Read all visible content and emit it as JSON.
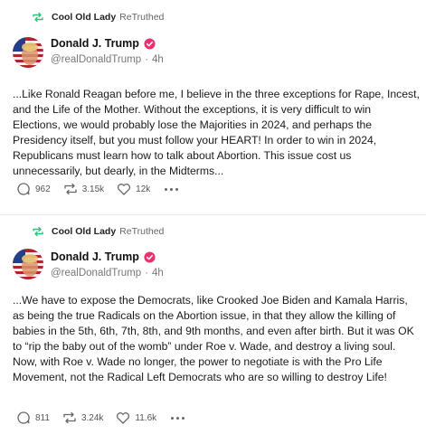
{
  "posts": [
    {
      "retruth_user": "Cool Old Lady",
      "retruth_action": "ReTruthed",
      "author_name": "Donald J. Trump",
      "author_handle": "@realDonaldTrump",
      "separator": "·",
      "time": "4h",
      "text": "...Like Ronald Reagan before me, I believe in the three exceptions for Rape, Incest, and the Life of the Mother. Without the exceptions, it is very difficult to win Elections, we would probably lose the Majorities in 2024, and perhaps the Presidency itself, but you must follow your HEART! In order to win in 2024, Republicans must learn how to talk about Abortion. This issue cost us unnecessarily, but dearly, in the Midterms...",
      "replies": "962",
      "retruths": "3.15k",
      "likes": "12k"
    },
    {
      "retruth_user": "Cool Old Lady",
      "retruth_action": "ReTruthed",
      "author_name": "Donald J. Trump",
      "author_handle": "@realDonaldTrump",
      "separator": "·",
      "time": "4h",
      "text": "...We have to expose the Democrats, like Crooked Joe Biden and Kamala Harris, as being the true Radicals on the Abortion issue, in that they allow the killing of babies in the 5th, 6th, 7th, 8th, and 9th months, and even after birth. But it was OK to “rip the baby out of the womb” under Roe v. Wade, and destroy a living soul. Now, with Roe v. Wade no longer, the power to negotiate is with the Pro Life Movement, not the Radical Left Democrats who are so willing to destroy Life!",
      "replies": "811",
      "retruths": "3.24k",
      "likes": "11.6k"
    }
  ],
  "icons": {
    "retruth": "retruth-icon",
    "verified": "verified-badge-icon",
    "reply": "reply-bubble-icon",
    "repost": "retruth-arrows-icon",
    "like": "heart-icon",
    "more": "more-dots-icon"
  },
  "colors": {
    "retruth_green": "#2ec27e",
    "verified_pink": "#e8336f",
    "muted": "#777777"
  }
}
